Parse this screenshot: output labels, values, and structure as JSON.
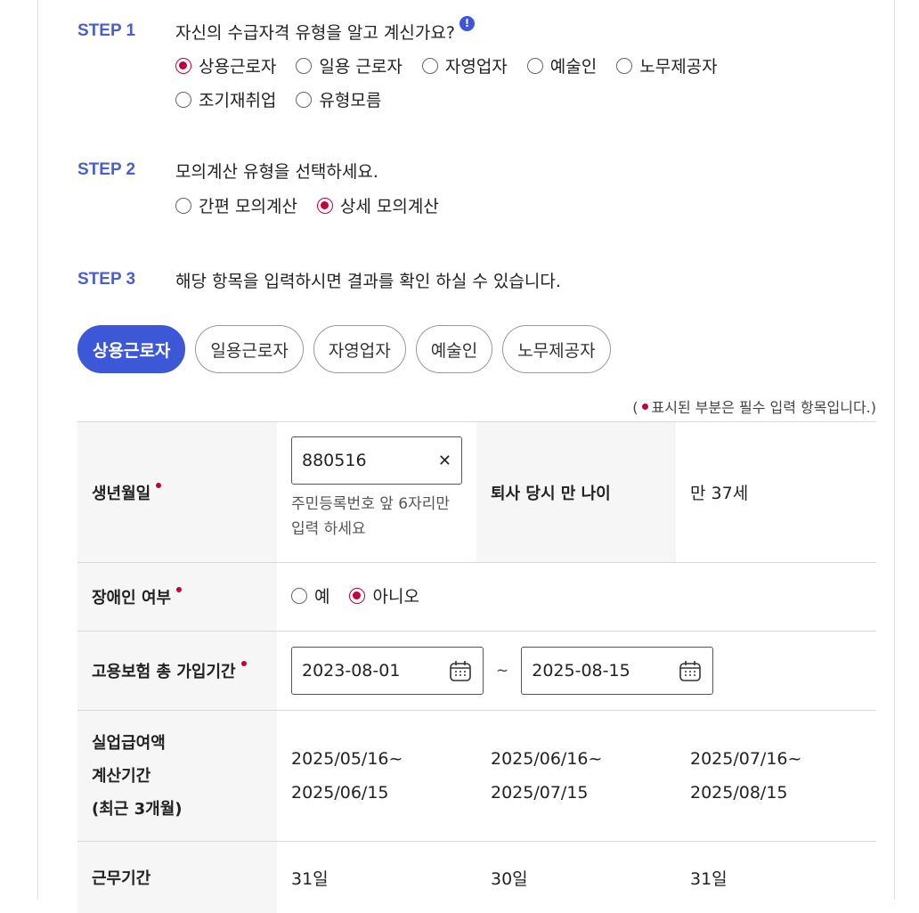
{
  "steps": {
    "step1": {
      "label": "STEP 1",
      "question": "자신의 수급자격 유형을 알고 계신가요?",
      "info_badge": "!",
      "options": [
        "상용근로자",
        "일용 근로자",
        "자영업자",
        "예술인",
        "노무제공자",
        "조기재취업",
        "유형모름"
      ],
      "selected": "상용근로자"
    },
    "step2": {
      "label": "STEP 2",
      "question": "모의계산 유형을 선택하세요.",
      "options": [
        "간편 모의계산",
        "상세 모의계산"
      ],
      "selected": "상세 모의계산"
    },
    "step3": {
      "label": "STEP 3",
      "question": "해당 항목을 입력하시면 결과를 확인 하실 수 있습니다."
    }
  },
  "tabs": [
    "상용근로자",
    "일용근로자",
    "자영업자",
    "예술인",
    "노무제공자"
  ],
  "active_tab": "상용근로자",
  "required_note": {
    "open": "(",
    "text": "표시된 부분은 필수 입력 항목입니다.)"
  },
  "form": {
    "birth": {
      "label": "생년월일",
      "value": "880516",
      "clear": "✕",
      "hint_line1": "주민등록번호 앞 6자리만",
      "hint_line2": "입력 하세요"
    },
    "age": {
      "label": "퇴사 당시 만 나이",
      "value": "만 37세"
    },
    "disability": {
      "label": "장애인 여부",
      "options": [
        "예",
        "아니오"
      ],
      "selected": "아니오"
    },
    "insurance": {
      "label": "고용보험 총 가입기간",
      "start": "2023-08-01",
      "separator": "~",
      "end": "2025-08-15"
    },
    "period": {
      "label_line1": "실업급여액",
      "label_line2": "계산기간",
      "label_line3": "(최근 3개월)",
      "cols": [
        {
          "from": "2025/05/16~",
          "to": "2025/06/15"
        },
        {
          "from": "2025/06/16~",
          "to": "2025/07/15"
        },
        {
          "from": "2025/07/16~",
          "to": "2025/08/15"
        }
      ]
    },
    "workdays": {
      "label": "근무기간",
      "values": [
        "31일",
        "30일",
        "31일"
      ]
    }
  },
  "colors": {
    "accent": "#3c58d6",
    "required": "#c2003a",
    "step_label": "#4a5fcf"
  }
}
